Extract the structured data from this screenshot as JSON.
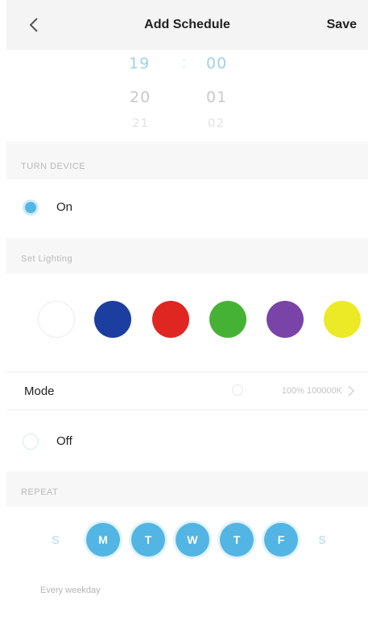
{
  "header": {
    "title": "Add Schedule",
    "save_label": "Save"
  },
  "time_picker": {
    "hour_selected": "19",
    "minute_selected": "00",
    "separator": ":",
    "hour_next": "20",
    "minute_next": "01",
    "hour_next2": "21",
    "minute_next2": "02"
  },
  "turn_device": {
    "section_label": "TURN DEVICE",
    "on_label": "On",
    "off_label": "Off",
    "selected": "On"
  },
  "lighting": {
    "section_label": "Set Lighting",
    "colors": [
      "#ffffff",
      "#1c3ea0",
      "#e02621",
      "#46b235",
      "#7a43a8",
      "#ecea26"
    ]
  },
  "mode": {
    "label": "Mode",
    "value": "100% 100000K"
  },
  "repeat": {
    "section_label": "REPEAT",
    "days": [
      {
        "label": "S",
        "selected": false
      },
      {
        "label": "M",
        "selected": true
      },
      {
        "label": "T",
        "selected": true
      },
      {
        "label": "W",
        "selected": true
      },
      {
        "label": "T",
        "selected": true
      },
      {
        "label": "F",
        "selected": true
      },
      {
        "label": "S",
        "selected": false
      }
    ],
    "summary": "Every weekday"
  }
}
